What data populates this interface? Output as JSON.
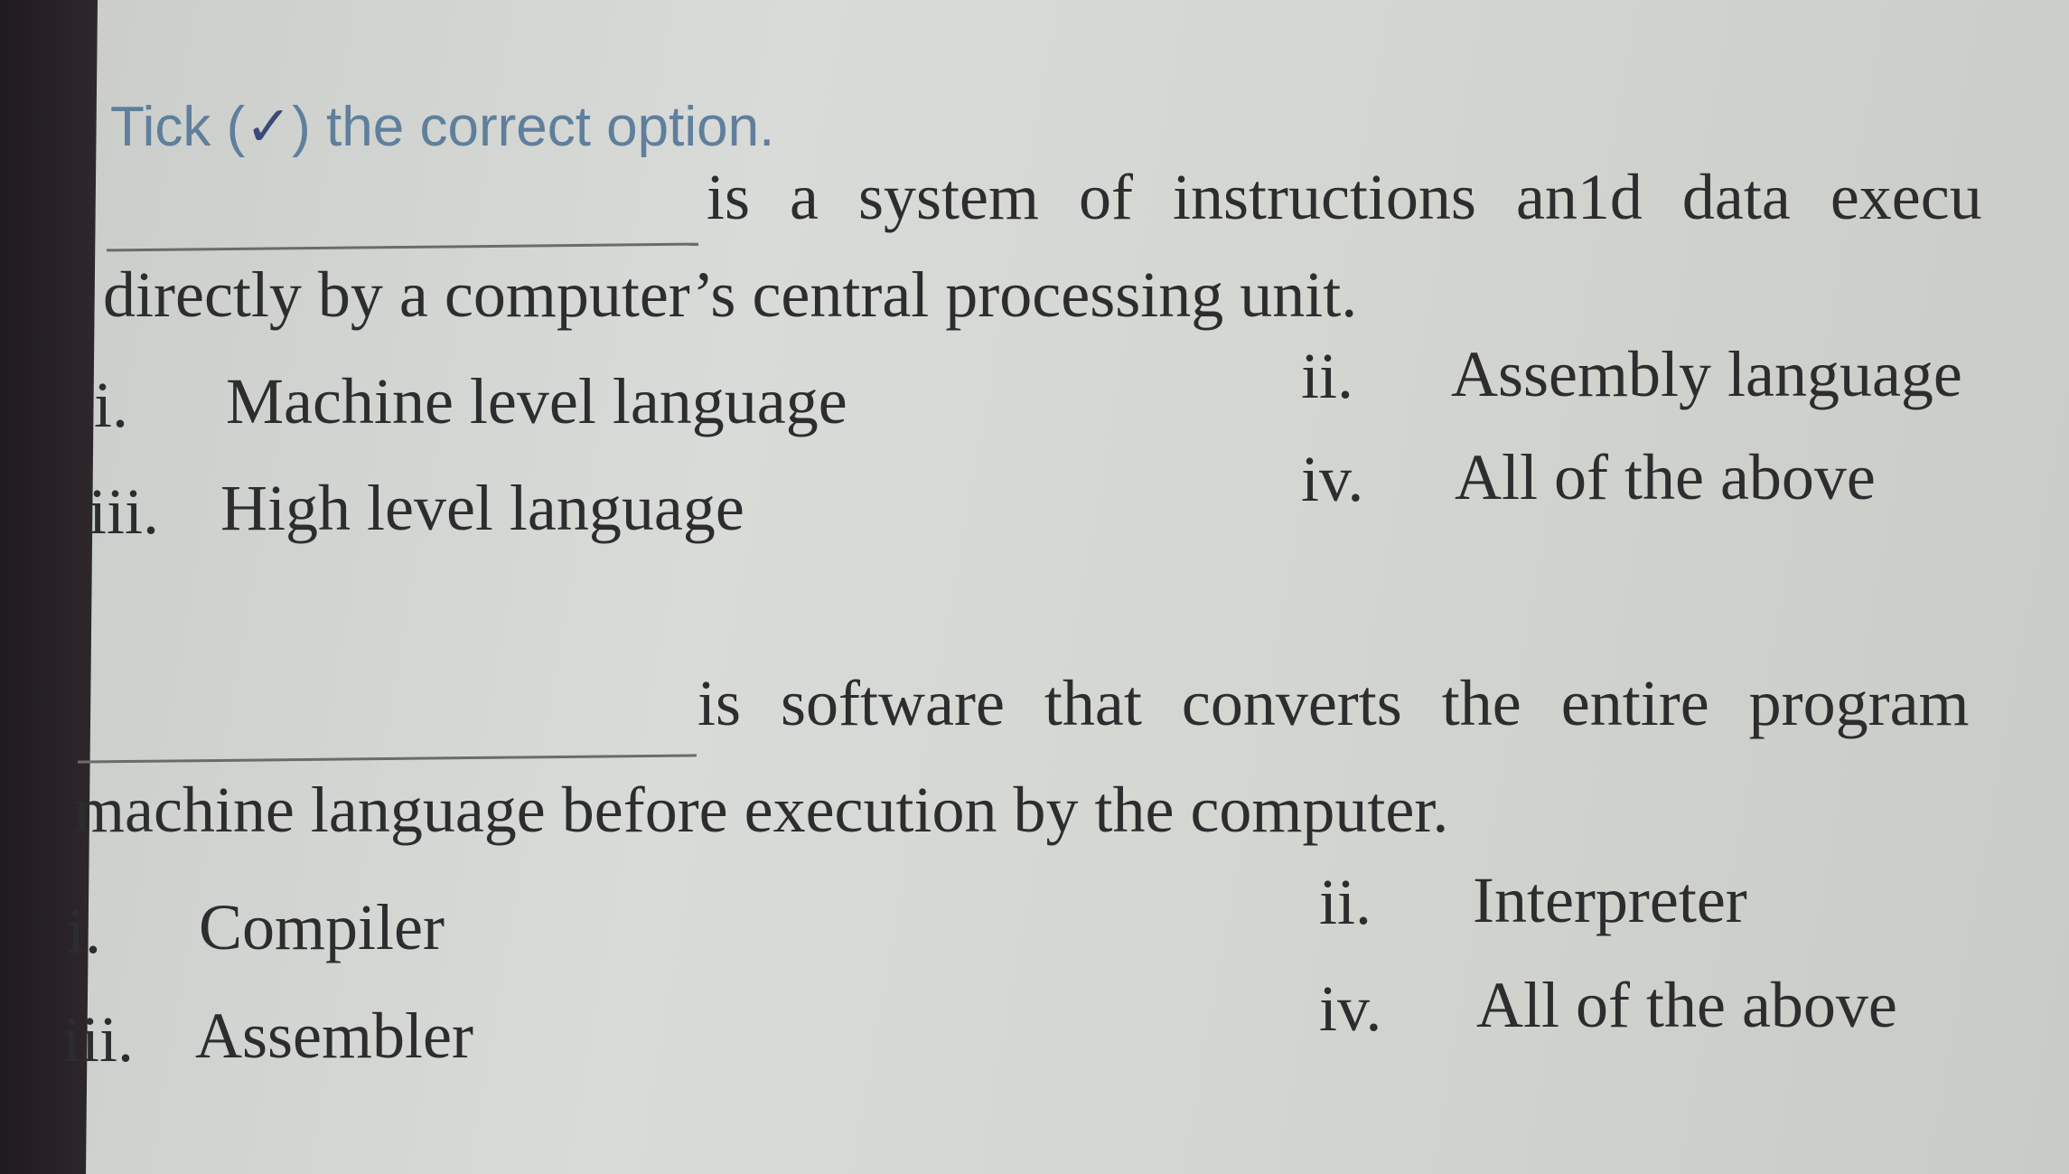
{
  "instruction": {
    "prefix": "Tick (",
    "tick_symbol": "✓",
    "suffix": ") the correct option."
  },
  "questions": [
    {
      "line1": "is a system of instructions an1d data execu",
      "line2": "directly by a computer’s central processing unit.",
      "options": [
        {
          "num": "i.",
          "text": "Machine level language"
        },
        {
          "num": "ii.",
          "text": "Assembly language"
        },
        {
          "num": "iii.",
          "text": "High level language"
        },
        {
          "num": "iv.",
          "text": "All of the above"
        }
      ]
    },
    {
      "line1": "is software that converts the entire program",
      "line2": "machine language before execution by the computer.",
      "options": [
        {
          "num": "i.",
          "text": "Compiler"
        },
        {
          "num": "ii.",
          "text": "Interpreter"
        },
        {
          "num": "iii.",
          "text": "Assembler"
        },
        {
          "num": "iv.",
          "text": "All of the above"
        }
      ]
    }
  ]
}
